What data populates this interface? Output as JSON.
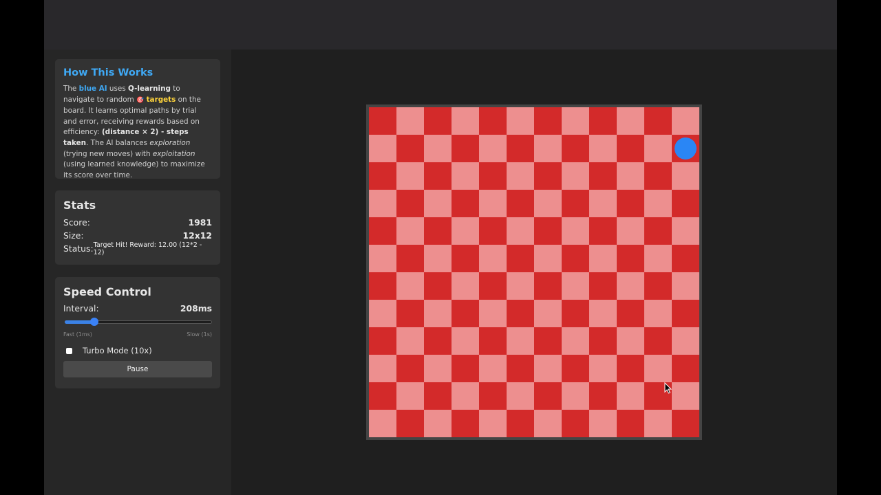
{
  "how_it_works": {
    "title": "How This Works",
    "t1": "The ",
    "blue_ai": "blue AI",
    "t2": " uses ",
    "qlearning": "Q-learning",
    "t3": " to navigate to random ",
    "target_glyph": "🎯",
    "targets": "targets",
    "t4": " on the board. It learns optimal paths by trial and error, receiving rewards based on efficiency: ",
    "formula": "(distance × 2) - steps taken",
    "t5": ". The AI balances ",
    "exploration": "exploration",
    "t6": " (trying new moves) with ",
    "exploitation": "exploitation",
    "t7": " (using learned knowledge) to maximize its score over time."
  },
  "stats": {
    "title": "Stats",
    "score_label": "Score:",
    "score_value": "1981",
    "size_label": "Size:",
    "size_value": "12x12",
    "status_label": "Status:",
    "status_value": "Target Hit! Reward: 12.00 (12*2 - 12)"
  },
  "speed": {
    "title": "Speed Control",
    "interval_label": "Interval:",
    "interval_value": "208ms",
    "slider_fraction": 0.2,
    "fast_label": "Fast (1ms)",
    "slow_label": "Slow (1s)",
    "turbo_label": "Turbo Mode (10x)",
    "turbo_checked": false,
    "pause_label": "Pause"
  },
  "board": {
    "rows": 12,
    "cols": 12,
    "agent_row": 1,
    "agent_col": 11,
    "colors": {
      "dark": "#d32a2a",
      "light": "#ed8f8f",
      "agent": "#2a86f5"
    }
  },
  "colors": {
    "accent_blue": "#3fa9f5",
    "target_yellow": "#ffd43b"
  }
}
